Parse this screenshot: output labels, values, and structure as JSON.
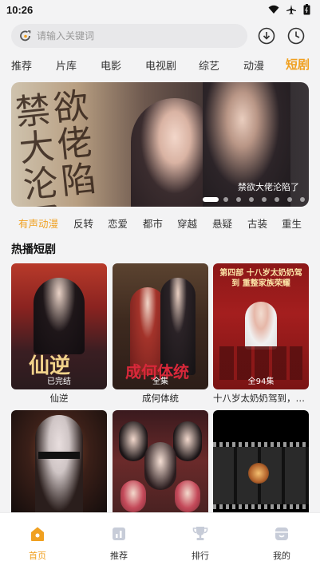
{
  "status": {
    "time": "10:26"
  },
  "search": {
    "placeholder": "请输入关键词"
  },
  "top_tabs": [
    "推荐",
    "片库",
    "电影",
    "电视剧",
    "综艺",
    "动漫",
    "短剧"
  ],
  "top_tabs_active": "短剧",
  "banner": {
    "caption": "禁欲大佬沦陷了",
    "calligraphy": "禁欲大佬沦陷了",
    "dots": 8,
    "active_dot": 0
  },
  "genres": [
    "有声动漫",
    "反转",
    "恋爱",
    "都市",
    "穿越",
    "悬疑",
    "古装",
    "重生"
  ],
  "genres_active": "有声动漫",
  "section": {
    "title": "热播短剧"
  },
  "dramas": [
    {
      "title": "仙逆",
      "badge": "已完结",
      "poster_text": "仙逆"
    },
    {
      "title": "成何体统",
      "badge": "全集",
      "poster_text": "成何体统"
    },
    {
      "title": "十八岁太奶奶驾到，重整家族荣耀",
      "badge": "全94集",
      "poster_text": "第四部 十八岁太奶奶驾到 重整家族荣耀"
    },
    {
      "title": "",
      "badge": "",
      "poster_text": ""
    },
    {
      "title": "",
      "badge": "",
      "poster_text": ""
    },
    {
      "title": "",
      "badge": "",
      "poster_text": ""
    }
  ],
  "bottom_nav": [
    {
      "label": "首页",
      "icon": "home-icon",
      "active": true
    },
    {
      "label": "推荐",
      "icon": "chart-icon",
      "active": false
    },
    {
      "label": "排行",
      "icon": "trophy-icon",
      "active": false
    },
    {
      "label": "我的",
      "icon": "profile-icon",
      "active": false
    }
  ],
  "colors": {
    "accent": "#f0a020",
    "background": "#f3f3f4"
  }
}
